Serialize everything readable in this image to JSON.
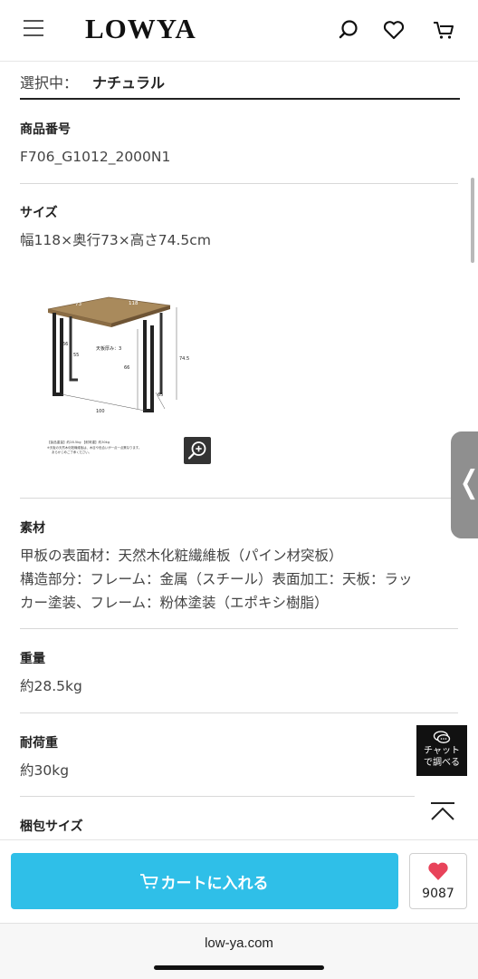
{
  "header": {
    "logo": "LOWYA",
    "icons": [
      "menu-icon",
      "search-icon",
      "heart-icon",
      "cart-icon"
    ]
  },
  "selection": {
    "label": "選択中：",
    "value": "ナチュラル"
  },
  "specs": {
    "product_number": {
      "title": "商品番号",
      "value": "F706_G1012_2000N1"
    },
    "size": {
      "title": "サイズ",
      "value": "幅118×奥行73×高さ74.5cm"
    },
    "diagram": {
      "dim_118": "118",
      "dim_73": "73",
      "dim_thickness": "天板厚み：3",
      "dim_745": "74.5",
      "dim_66a": "66",
      "dim_55": "55",
      "dim_66b": "66",
      "dim_65": "65",
      "dim_100": "100",
      "note1": "【製品重量】約28.5kg 【耐荷重】約30kg",
      "note2": "※天板の天然木化粧繊維板は、木目や色合いが一点一点異なります。",
      "note3": "あらかじめご了承ください。"
    },
    "material": {
      "title": "素材",
      "line1": "甲板の表面材：天然木化粧繊維板（パイン材突板）",
      "line2": "構造部分：フレーム：金属（スチール）表面加工：天板：ラッ",
      "line3": "カー塗装、フレーム：粉体塗装（エポキシ樹脂）"
    },
    "weight": {
      "title": "重量",
      "value": "約28.5kg"
    },
    "load": {
      "title": "耐荷重",
      "value": "約30kg"
    },
    "package": {
      "title": "梱包サイズ"
    }
  },
  "chat": {
    "line1": "チャット",
    "line2": "で調べる"
  },
  "bottom": {
    "cart_label": "カートに入れる",
    "fav_count": "9087"
  },
  "browser": {
    "url": "low-ya.com"
  },
  "colors": {
    "cart_button": "#2fbfe8",
    "heart": "#e8435a"
  }
}
